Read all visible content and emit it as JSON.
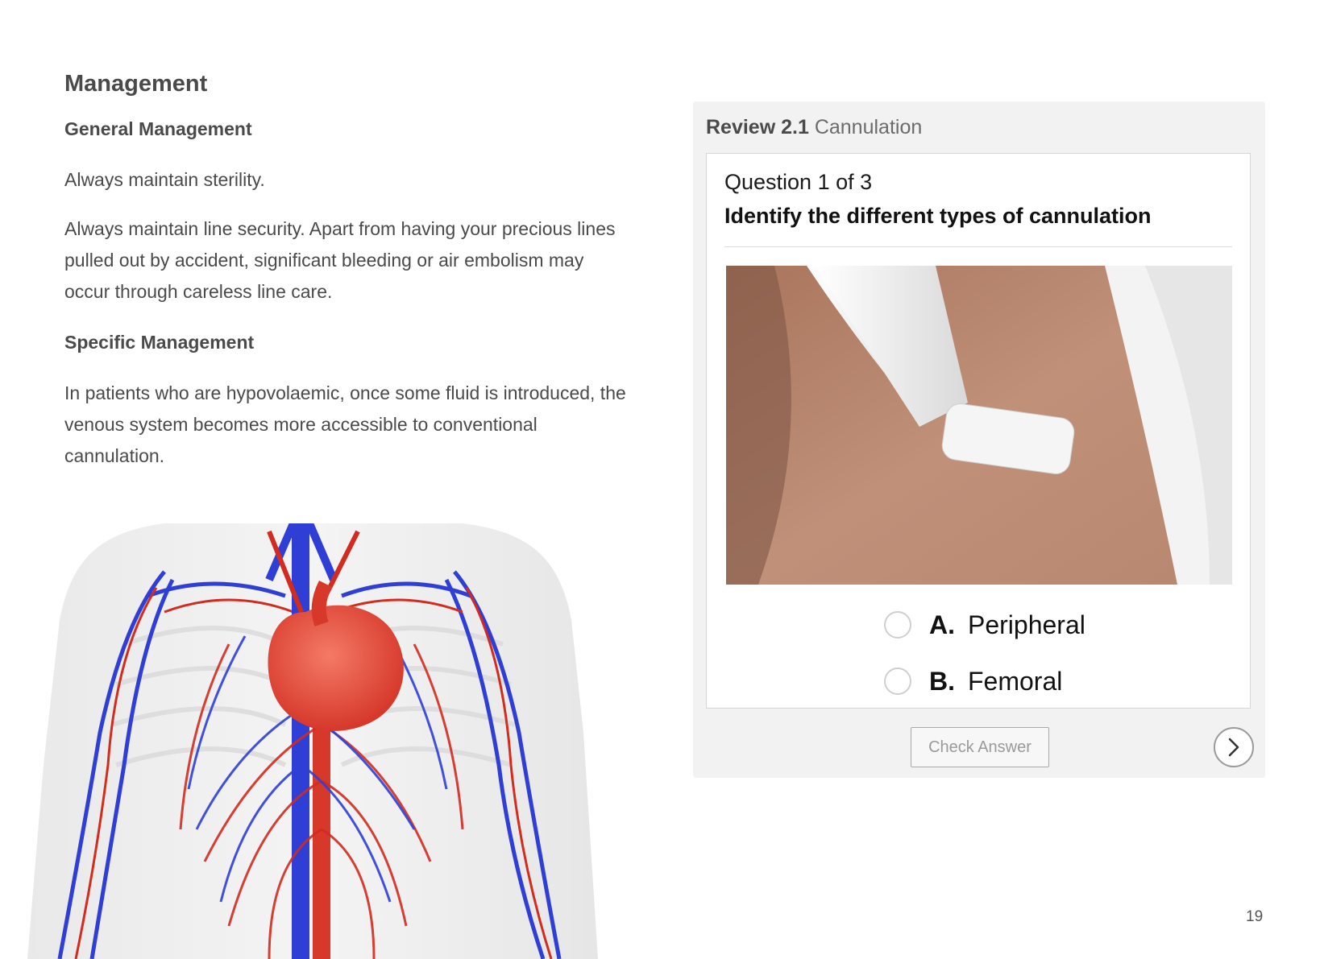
{
  "left": {
    "heading": "Management",
    "subheading_general": "General Management",
    "para_sterility": "Always maintain sterility.",
    "para_security": "Always maintain line security. Apart from having your precious lines pulled out by accident, significant bleeding or air embolism may occur through careless line care.",
    "subheading_specific": "Specific Management",
    "para_hypovolaemic": "In patients who are hypovolaemic, once some fluid is introduced, the venous system becomes more accessible to conventional cannulation."
  },
  "figure": {
    "description_icon": "circulatory-system-illustration"
  },
  "review": {
    "label": "Review 2.1",
    "title": "Cannulation",
    "question_count": "Question 1 of 3",
    "question": "Identify the different types of cannulation",
    "image_icon": "ultrasound-probe-on-arm-photo",
    "options": [
      {
        "letter": "A.",
        "text": "Peripheral"
      },
      {
        "letter": "B.",
        "text": "Femoral"
      }
    ],
    "check_button": "Check Answer",
    "next_icon": "chevron-right-icon"
  },
  "page_number": "19"
}
